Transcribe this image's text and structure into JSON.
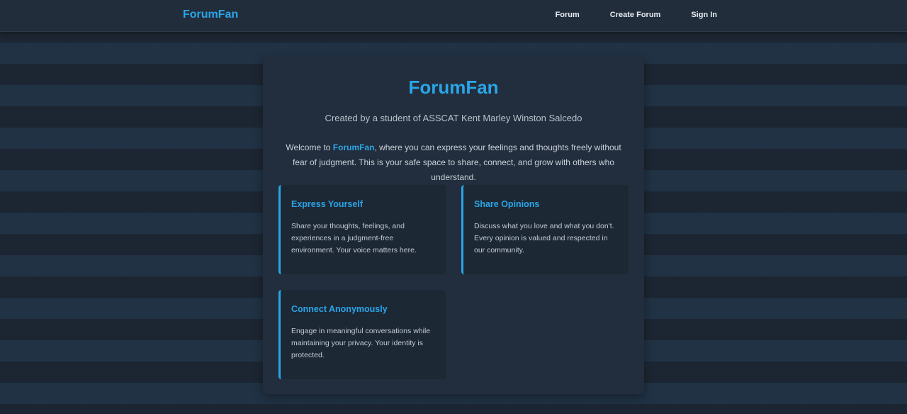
{
  "nav": {
    "brand": "ForumFan",
    "links": [
      "Forum",
      "Create Forum",
      "Sign In"
    ]
  },
  "main": {
    "title": "ForumFan",
    "subtitle": "Created by a student of ASSCAT Kent Marley Winston Salcedo",
    "intro_prefix": "Welcome to ",
    "intro_brand": "ForumFan",
    "intro_suffix": ", where you can express your feelings and thoughts freely without fear of judgment. This is your safe space to share, connect, and grow with others who understand."
  },
  "features": [
    {
      "title": "Express Yourself",
      "description": "Share your thoughts, feelings, and experiences in a judgment-free environment. Your voice matters here."
    },
    {
      "title": "Share Opinions",
      "description": "Discuss what you love and what you don't. Every opinion is valued and respected in our community."
    },
    {
      "title": "Connect Anonymously",
      "description": "Engage in meaningful conversations while maintaining your privacy. Your identity is protected."
    }
  ],
  "colors": {
    "accent": "#2aa5e8",
    "background": "#1c2632",
    "card": "#222e3d",
    "feature_card": "#1d2835"
  }
}
